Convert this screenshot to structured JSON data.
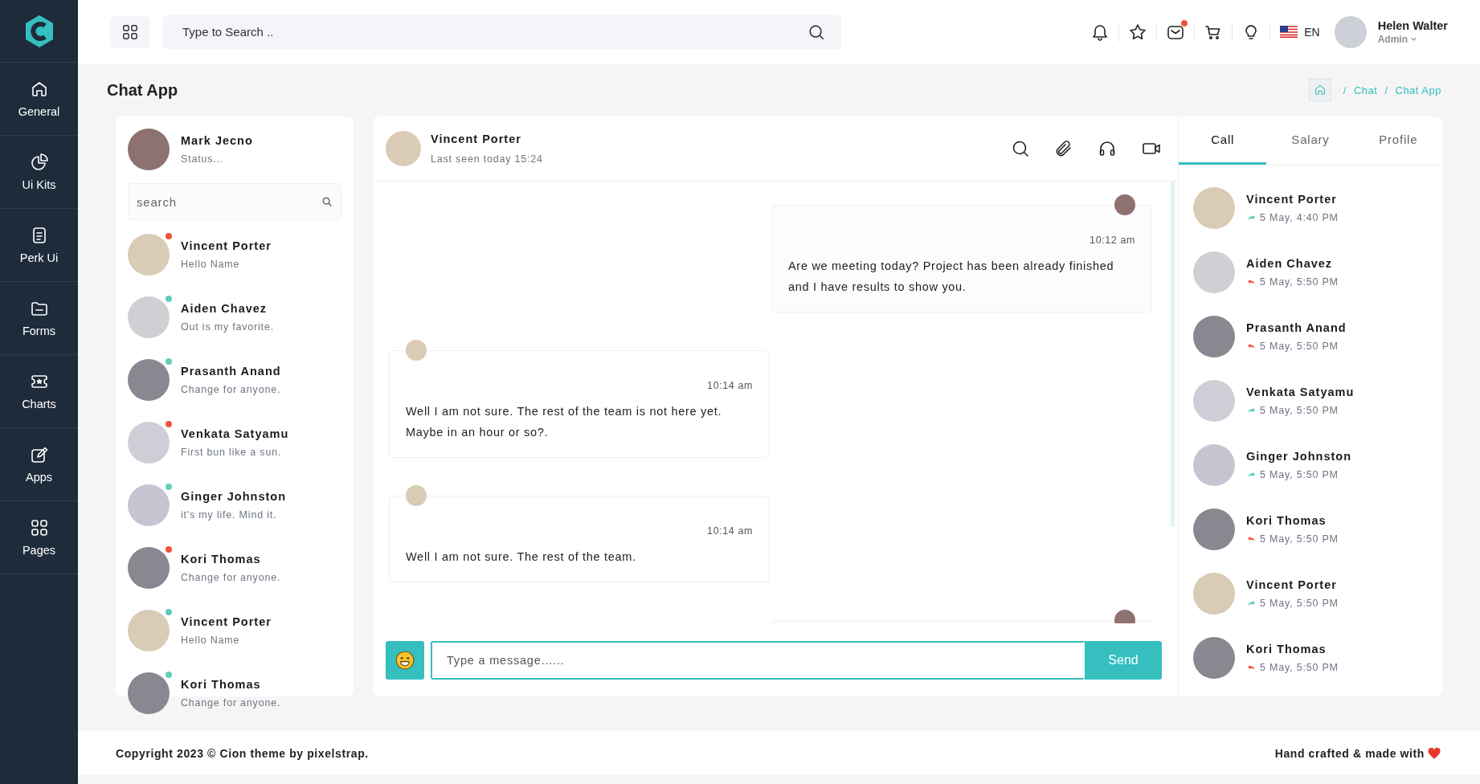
{
  "sidebar": {
    "items": [
      {
        "label": "General"
      },
      {
        "label": "Ui Kits"
      },
      {
        "label": "Perk Ui"
      },
      {
        "label": "Forms"
      },
      {
        "label": "Charts"
      },
      {
        "label": "Apps"
      },
      {
        "label": "Pages"
      }
    ]
  },
  "header": {
    "search": {
      "placeholder": "Type to Search .."
    },
    "icons": [
      {
        "badge": false
      },
      {
        "badge": false
      },
      {
        "badge": true
      },
      {
        "badge": false
      },
      {
        "badge": false
      }
    ],
    "language": "EN",
    "user": {
      "name": "Helen Walter",
      "role": "Admin"
    }
  },
  "page": {
    "title": "Chat App",
    "breadcrumb": [
      {
        "separator": "/",
        "label": "Chat"
      },
      {
        "separator": "/",
        "label": "Chat App"
      }
    ]
  },
  "profile": {
    "name": "Mark Jecno",
    "status": "Status..."
  },
  "chat_search": {
    "placeholder": "search"
  },
  "chats": [
    {
      "name": "Vincent Porter",
      "message": "Hello Name",
      "color": "#f0533e"
    },
    {
      "name": "Aiden Chavez",
      "message": "Out is my favorite.",
      "color": "#5fcfb8"
    },
    {
      "name": "Prasanth Anand",
      "message": "Change for anyone.",
      "color": "#5fcfb8"
    },
    {
      "name": "Venkata Satyamu",
      "message": "First bun like a sun.",
      "color": "#f0533e"
    },
    {
      "name": "Ginger Johnston",
      "message": "it's my life. Mind it.",
      "color": "#5fcfb8"
    },
    {
      "name": "Kori Thomas",
      "message": "Change for anyone.",
      "color": "#f0533e"
    },
    {
      "name": "Vincent Porter",
      "message": "Hello Name",
      "color": "#5fcfb8"
    },
    {
      "name": "Kori Thomas",
      "message": "Change for anyone.",
      "color": "#5fcfb8"
    }
  ],
  "conversation": {
    "name": "Vincent Porter",
    "last_seen": "Last seen today 15:24",
    "messages": [
      {
        "kind": "sent",
        "time": "10:12 am",
        "text": "Are we meeting today? Project has been already finished and I have results to show you."
      },
      {
        "kind": "received",
        "time": "10:14 am",
        "text": "Well I am not sure. The rest of the team is not here yet. Maybe in an hour or so?."
      },
      {
        "kind": "received",
        "time": "10:14 am",
        "text": "Well I am not sure. The rest of the team."
      },
      {
        "kind": "sent"
      }
    ],
    "input": {
      "placeholder": "Type a message......"
    },
    "send": "Send"
  },
  "tabs": [
    {
      "label": "Call",
      "selected": true
    },
    {
      "label": "Salary",
      "selected": false
    },
    {
      "label": "Profile",
      "selected": false
    }
  ],
  "calls": [
    {
      "name": "Vincent Porter",
      "time": "5 May, 4:40 PM",
      "kind": "outgoing"
    },
    {
      "name": "Aiden Chavez",
      "time": "5 May, 5:50 PM",
      "kind": "incoming"
    },
    {
      "name": "Prasanth Anand",
      "time": "5 May, 5:50 PM",
      "kind": "incoming"
    },
    {
      "name": "Venkata Satyamu",
      "time": "5 May, 5:50 PM",
      "kind": "outgoing"
    },
    {
      "name": "Ginger Johnston",
      "time": "5 May, 5:50 PM",
      "kind": "outgoing"
    },
    {
      "name": "Kori Thomas",
      "time": "5 May, 5:50 PM",
      "kind": "incoming"
    },
    {
      "name": "Vincent Porter",
      "time": "5 May, 5:50 PM",
      "kind": "outgoing"
    },
    {
      "name": "Kori Thomas",
      "time": "5 May, 5:50 PM",
      "kind": "incoming"
    }
  ],
  "footer": {
    "copyright": "Copyright 2023 © Cion theme by pixelstrap.",
    "credit": "Hand crafted & made with"
  }
}
